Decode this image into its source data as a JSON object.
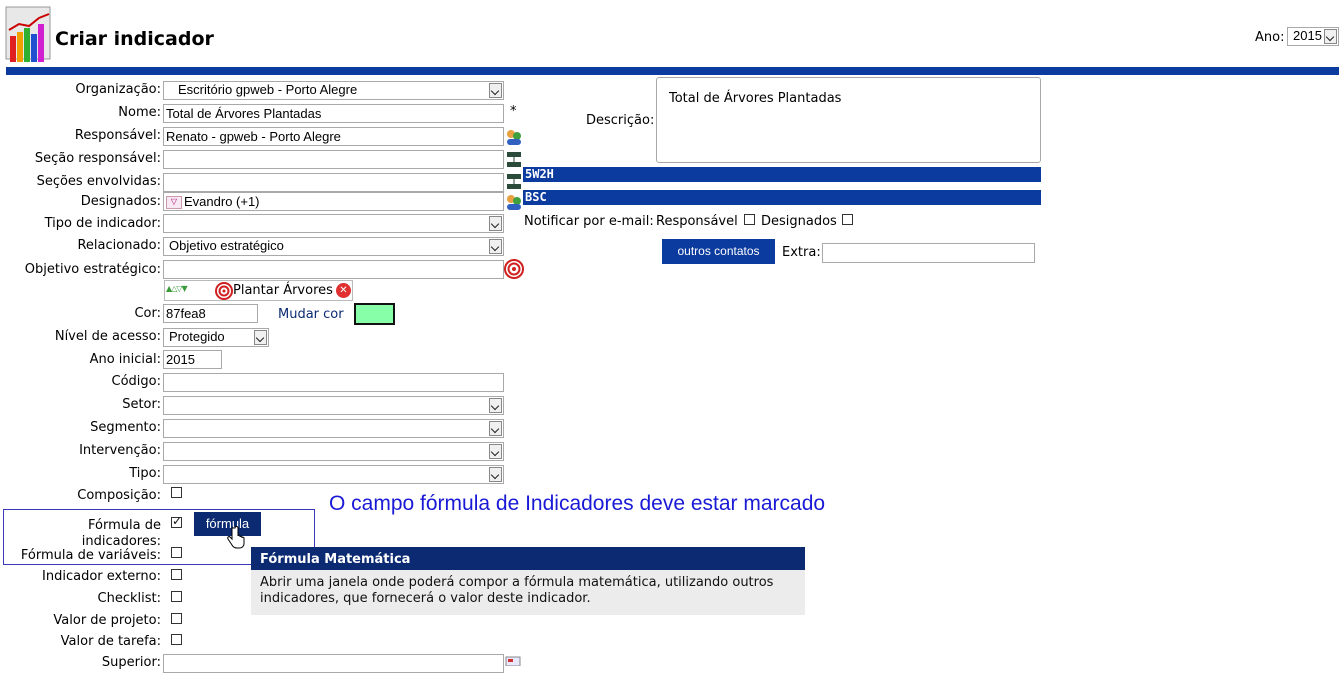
{
  "header": {
    "title": "Criar indicador",
    "year_label": "Ano:",
    "year_value": "2015"
  },
  "colors": {
    "brand_blue": "#0b3b9e",
    "button_blue": "#0b3b9e",
    "chosen_color": "#87fea8",
    "tooltip_header": "#0b2a72",
    "annotation": "#1a1ad6"
  },
  "form": {
    "organizacao": {
      "label": "Organização:",
      "value": "Escritório gpweb - Porto Alegre"
    },
    "nome": {
      "label": "Nome:",
      "value": "Total de Árvores Plantadas",
      "required_mark": "*"
    },
    "responsavel": {
      "label": "Responsável:",
      "value": "Renato - gpweb - Porto Alegre"
    },
    "secao_responsavel": {
      "label": "Seção responsável:",
      "value": ""
    },
    "secoes_envolvidas": {
      "label": "Seções envolvidas:",
      "value": ""
    },
    "designados": {
      "label": "Designados:",
      "value": "Evandro (+1)"
    },
    "tipo_indicador": {
      "label": "Tipo de indicador:",
      "value": ""
    },
    "relacionado": {
      "label": "Relacionado:",
      "value": "Objetivo estratégico"
    },
    "objetivo_estrategico": {
      "label": "Objetivo estratégico:",
      "value": "",
      "item": "Plantar Árvores"
    },
    "cor": {
      "label": "Cor:",
      "value": "87fea8",
      "change_label": "Mudar cor"
    },
    "nivel_acesso": {
      "label": "Nível de acesso:",
      "value": "Protegido"
    },
    "ano_inicial": {
      "label": "Ano inicial:",
      "value": "2015"
    },
    "codigo": {
      "label": "Código:",
      "value": ""
    },
    "setor": {
      "label": "Setor:",
      "value": ""
    },
    "segmento": {
      "label": "Segmento:",
      "value": ""
    },
    "intervencao": {
      "label": "Intervenção:",
      "value": ""
    },
    "tipo": {
      "label": "Tipo:",
      "value": ""
    },
    "composicao": {
      "label": "Composição:"
    },
    "formula_indicadores": {
      "label": "Fórmula de indicadores:",
      "button": "fórmula"
    },
    "formula_variaveis": {
      "label": "Fórmula de variáveis:"
    },
    "indicador_externo": {
      "label": "Indicador externo:"
    },
    "checklist": {
      "label": "Checklist:"
    },
    "valor_projeto": {
      "label": "Valor de projeto:"
    },
    "valor_tarefa": {
      "label": "Valor de tarefa:"
    },
    "superior": {
      "label": "Superior:"
    }
  },
  "right": {
    "descricao_label": "Descrição:",
    "descricao_value": "Total de Árvores Plantadas",
    "section_5w2h": "5W2H",
    "section_bsc": "BSC",
    "notify_label": "Notificar por e-mail:",
    "notify_responsavel": "Responsável",
    "notify_designados": "Designados",
    "outros_contatos": "outros contatos",
    "extra_label": "Extra:"
  },
  "annotation": "O campo fórmula de Indicadores deve estar marcado",
  "tooltip": {
    "title": "Fórmula Matemática",
    "body": "Abrir uma janela onde poderá compor a fórmula matemática, utilizando outros indicadores, que fornecerá o valor deste indicador."
  }
}
